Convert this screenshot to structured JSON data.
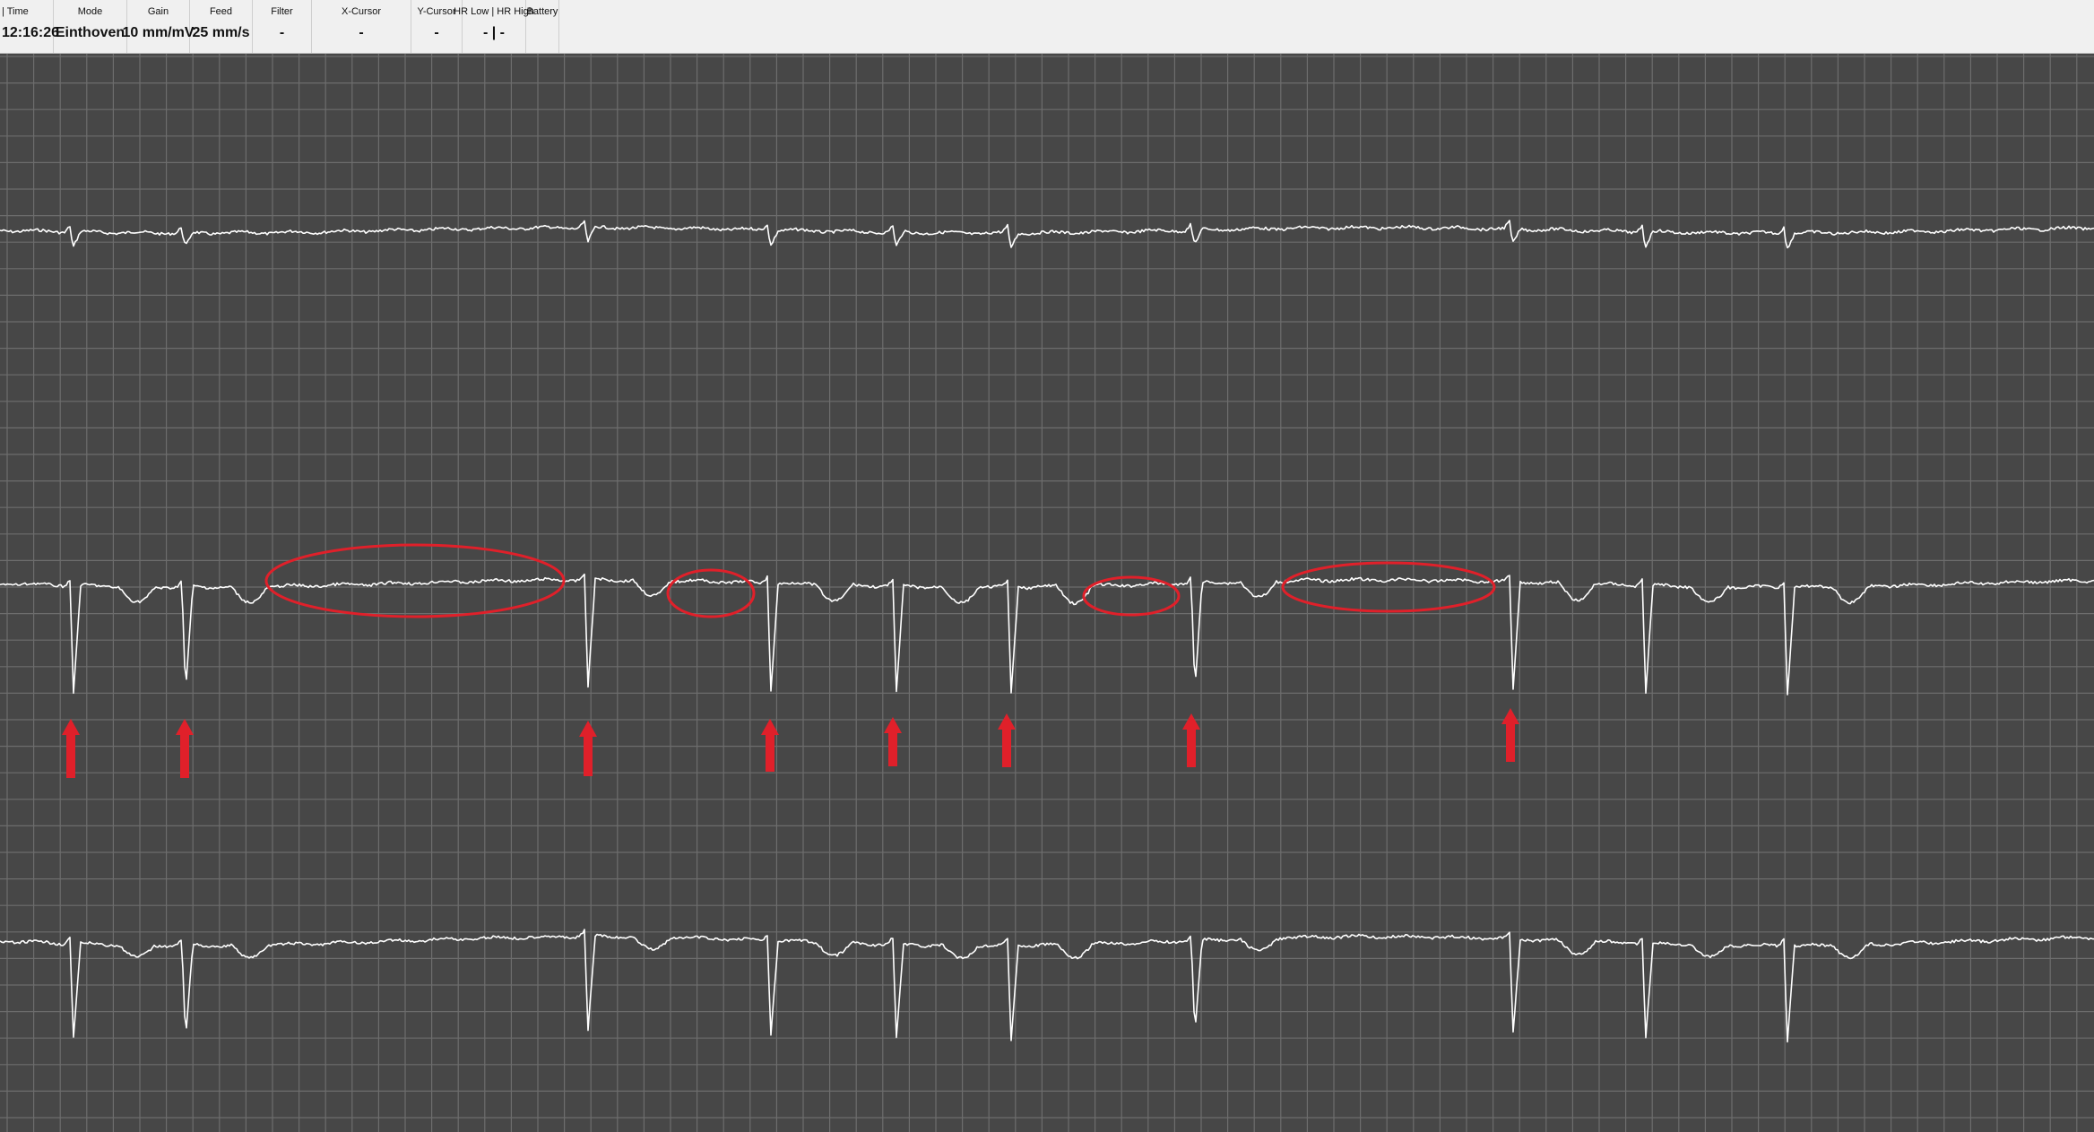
{
  "status_bar": {
    "time": {
      "label": "| Time",
      "value": "12:16:26"
    },
    "mode": {
      "label": "Mode",
      "value": "Einthoven"
    },
    "gain": {
      "label": "Gain",
      "value": "10 mm/mV"
    },
    "feed": {
      "label": "Feed",
      "value": "25 mm/s"
    },
    "filter": {
      "label": "Filter",
      "value": "-"
    },
    "x_cursor": {
      "label": "X-Cursor",
      "value": "-"
    },
    "y_cursor": {
      "label": "Y-Cursor",
      "value": "-"
    },
    "hr": {
      "label": "HR Low | HR High",
      "value": "- | -"
    },
    "battery": {
      "label": "Battery",
      "value": ""
    }
  },
  "colors": {
    "grid_background": "#474747",
    "grid_line": "#6d6d6d",
    "trace": "#ffffff",
    "annotation": "#e0202a",
    "status_bar_background": "#f0f0f0"
  },
  "ecg": {
    "leads_shown": 3,
    "annotations": {
      "arrows_marked_beats": 8,
      "ellipses_marked_segments": 4,
      "annotation_color_name": "red"
    }
  }
}
